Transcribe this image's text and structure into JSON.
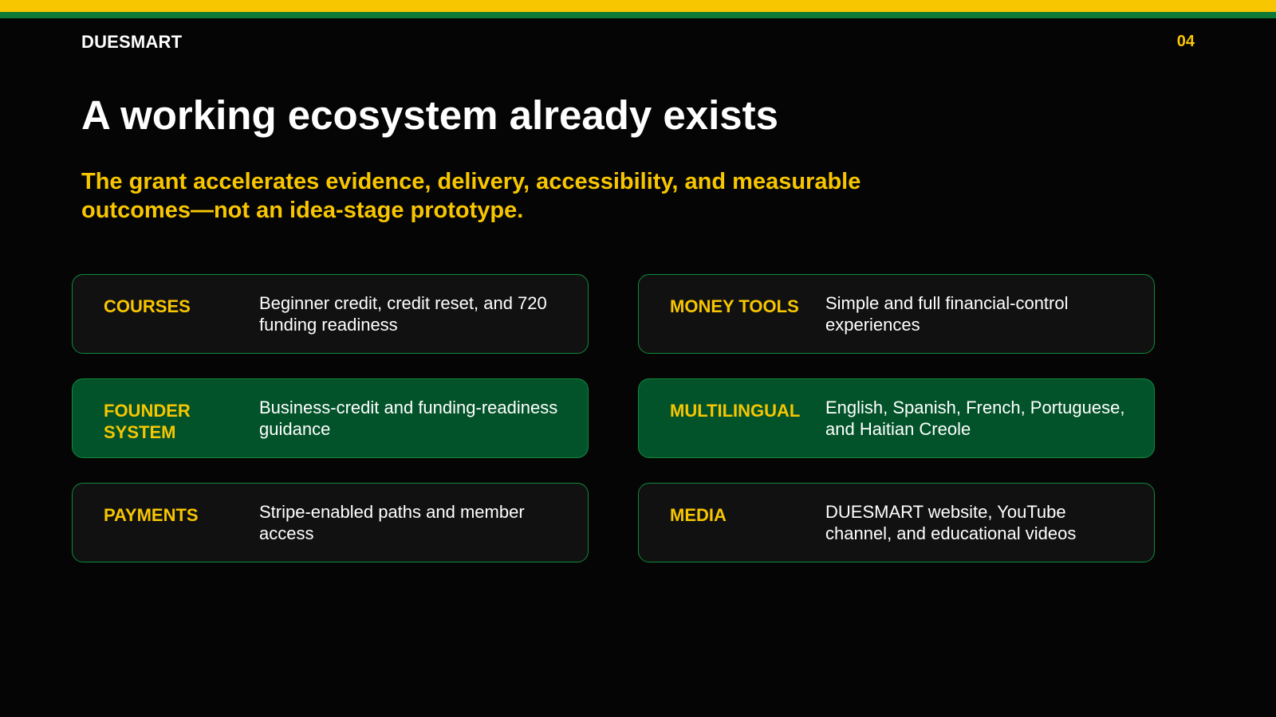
{
  "header": {
    "brand": "DUESMART",
    "page_number": "04"
  },
  "slide": {
    "title": "A working ecosystem already exists",
    "subtitle": "The grant accelerates evidence, delivery, accessibility, and measurable outcomes—not an idea-stage prototype."
  },
  "cards": [
    {
      "label": "COURSES",
      "text": "Beginner credit, credit reset, and 720 funding readiness",
      "highlight": false
    },
    {
      "label": "MONEY TOOLS",
      "text": "Simple and full financial-control experiences",
      "highlight": false
    },
    {
      "label": "FOUNDER SYSTEM",
      "text": "Business-credit and funding-readiness guidance",
      "highlight": true
    },
    {
      "label": "MULTILINGUAL",
      "text": "English, Spanish, French, Portuguese, and Haitian Creole",
      "highlight": true
    },
    {
      "label": "PAYMENTS",
      "text": "Stripe-enabled paths and member access",
      "highlight": false
    },
    {
      "label": "MEDIA",
      "text": "DUESMART website, YouTube channel, and educational videos",
      "highlight": false
    }
  ],
  "colors": {
    "accent_yellow": "#f7c600",
    "accent_green": "#0d7a36",
    "card_highlight": "#03532a",
    "card_default": "#111111",
    "background": "#050505"
  }
}
